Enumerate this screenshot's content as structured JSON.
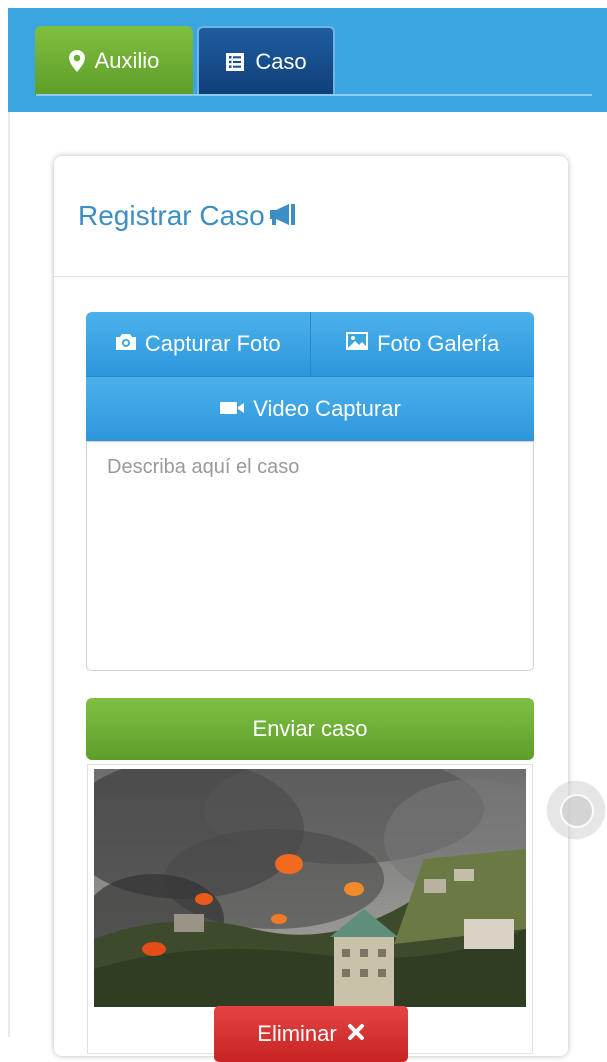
{
  "tabs": {
    "auxilio": {
      "label": "Auxilio",
      "icon": "map-marker-icon",
      "color": "#6aaf31"
    },
    "caso": {
      "label": "Caso",
      "icon": "list-icon",
      "color": "#174e8c"
    }
  },
  "header": {
    "color": "#3aa5e1"
  },
  "card": {
    "title": "Registrar Caso",
    "title_icon": "megaphone-icon",
    "buttons": {
      "capture_photo": {
        "label": "Capturar Foto",
        "icon": "camera-icon"
      },
      "gallery_photo": {
        "label": "Foto Galería",
        "icon": "picture-icon"
      },
      "capture_video": {
        "label": "Video Capturar",
        "icon": "video-camera-icon"
      }
    },
    "description": {
      "placeholder": "Describa aquí el caso",
      "value": ""
    },
    "send_button": {
      "label": "Enviar caso",
      "color": "#6aaf31"
    },
    "delete_button": {
      "label": "Eliminar",
      "icon": "close-icon",
      "color": "#d63131"
    }
  }
}
